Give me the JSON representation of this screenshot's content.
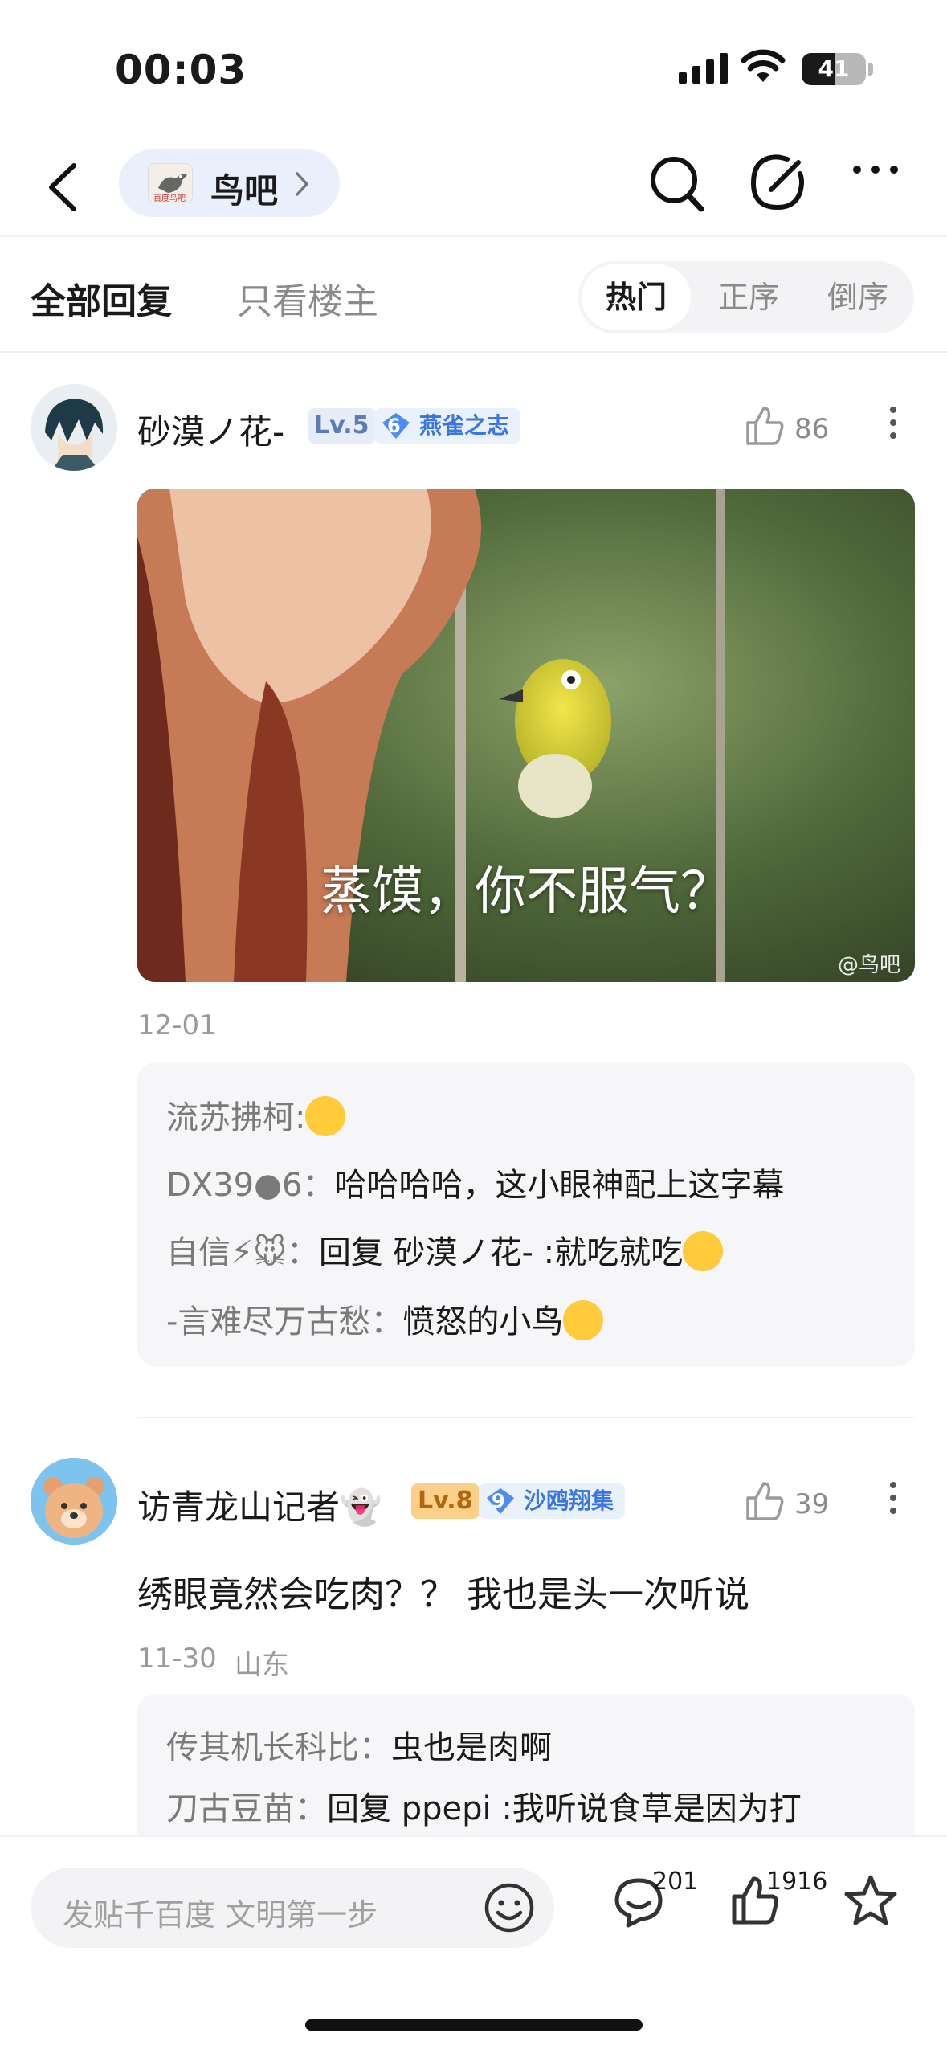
{
  "status_bar": {
    "time": "00:03",
    "battery": "41"
  },
  "nav": {
    "forum_name": "鸟吧",
    "forum_logo_text": "百度鸟吧"
  },
  "tabs": {
    "all": "全部回复",
    "op_only": "只看楼主"
  },
  "sort": {
    "hot": "热门",
    "asc": "正序",
    "desc": "倒序"
  },
  "comments": [
    {
      "username": "砂漠ノ花-",
      "level": "Lv.5",
      "badge_level": "6",
      "badge_title": "燕雀之志",
      "likes": "86",
      "image_caption": "蒸馍，你不服气？",
      "image_watermark": "@鸟吧",
      "date": "12-01",
      "replies": [
        {
          "name": "流苏拂柯",
          "sep": ":",
          "text": ""
        },
        {
          "name": "DX39●6",
          "sep": "：",
          "text": "哈哈哈哈，这小眼神配上这字幕"
        },
        {
          "name": "自信⚡🐭",
          "sep": "：",
          "text": "回复 砂漠ノ花- :就吃就吃"
        },
        {
          "name": "-言难尽万古愁",
          "sep": "：",
          "text": "愤怒的小鸟"
        }
      ]
    },
    {
      "username": "访青龙山记者👻",
      "level": "Lv.8",
      "badge_level": "9",
      "badge_title": "沙鸥翔集",
      "likes": "39",
      "text": "绣眼竟然会吃肉？？ 我也是头一次听说",
      "date": "11-30",
      "location": "山东",
      "replies": [
        {
          "name": "传其机长科比",
          "sep": "：",
          "text": "虫也是肉啊"
        },
        {
          "name": "刀古豆苗",
          "sep": "：",
          "text": "回复 ppepi :我听说食草是因为打"
        }
      ]
    }
  ],
  "bottom_bar": {
    "input_placeholder": "发贴千百度 文明第一步",
    "comment_count": "201",
    "like_count": "1916"
  },
  "colors": {
    "accent_blue": "#3a76e3",
    "lv5_bg": "#e6edf8",
    "lv8_bg": "#fbd18a",
    "reply_bg": "#f6f6f8"
  }
}
